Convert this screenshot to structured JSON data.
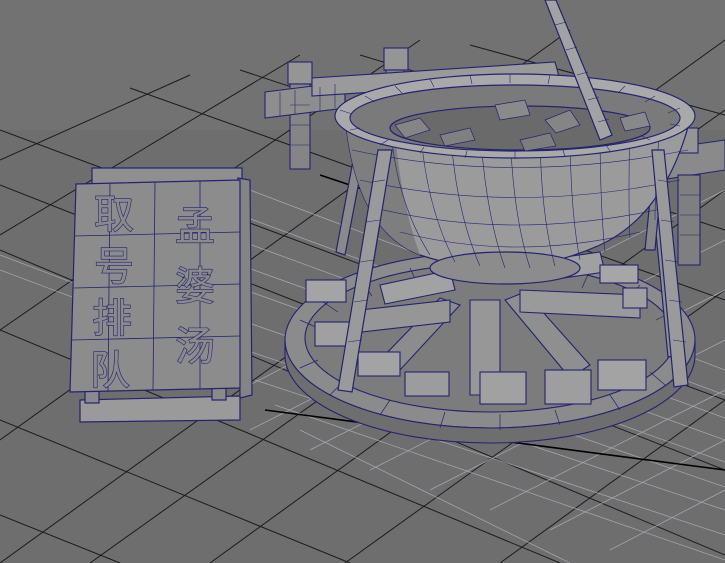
{
  "scene": {
    "colors": {
      "background": "#6f6f6f",
      "grid_line": "#1f1f1f",
      "grid_near": "#4a4a4a",
      "grid_highlight": "#b9b9c6",
      "axis": "#000000",
      "mesh_fill": "#8b8b8b",
      "mesh_shadow": "#616161",
      "wire": "#23236f"
    },
    "objects": [
      {
        "name": "queue-sign",
        "icon": "signboard-icon"
      },
      {
        "name": "soup-cauldron",
        "icon": "cauldron-icon"
      },
      {
        "name": "wooden-table",
        "icon": "table-icon"
      },
      {
        "name": "campfire",
        "icon": "firewood-icon"
      }
    ],
    "sign": {
      "left_column": [
        "取",
        "号",
        "排",
        "队"
      ],
      "right_column": [
        "孟",
        "婆",
        "汤"
      ]
    }
  }
}
